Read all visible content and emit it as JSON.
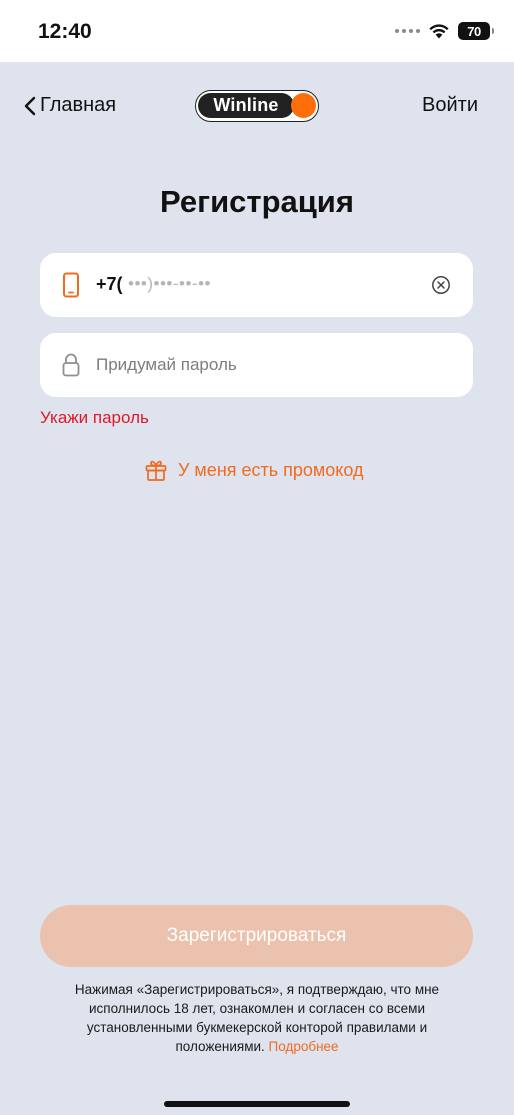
{
  "status_bar": {
    "time": "12:40",
    "battery": "70"
  },
  "nav": {
    "back_label": "Главная",
    "logo_text": "Winline",
    "login_label": "Войти"
  },
  "title": "Регистрация",
  "phone_field": {
    "prefix": "+7(",
    "mask": "•••)•••-••-••"
  },
  "password_field": {
    "placeholder": "Придумай пароль",
    "value": ""
  },
  "error_message": "Укажи пароль",
  "promo_label": "У меня есть промокод",
  "submit_label": "Зарегистрироваться",
  "terms": {
    "text": "Нажимая «Зарегистрироваться», я подтверждаю, что мне исполнилось 18 лет, ознакомлен и согласен со всеми установленными букмекерской конторой правилами и положениями.",
    "link_label": "Подробнее"
  },
  "colors": {
    "accent": "#f26a1e",
    "error": "#e0192a",
    "background": "#dfe3ee",
    "button_disabled": "#ebc2ad"
  }
}
